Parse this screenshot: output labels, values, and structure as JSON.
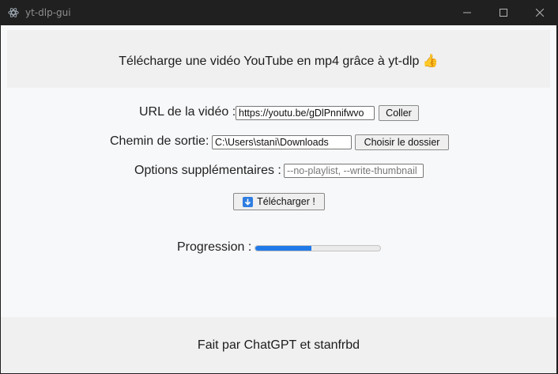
{
  "window": {
    "title": "yt-dlp-gui",
    "minimize_icon": "minimize-icon",
    "maximize_icon": "maximize-icon",
    "close_icon": "close-icon"
  },
  "header": {
    "text": "Télécharge une vidéo YouTube en mp4 grâce à yt-dlp 👍"
  },
  "form": {
    "url_label": "URL de la vidéo :",
    "url_value": "https://youtu.be/gDlPnnifwvo",
    "paste_button": "Coller",
    "output_label": "Chemin de sortie:",
    "output_value": "C:\\Users\\stani\\Downloads",
    "choose_folder_button": "Choisir le dossier",
    "options_label": "Options supplémentaires :",
    "options_placeholder": "--no-playlist, --write-thumbnail",
    "download_button": "Télécharger !",
    "download_icon": "download-arrow-icon"
  },
  "progress": {
    "label": "Progression :",
    "value": 0.45,
    "color": "#1f7ae8"
  },
  "footer": {
    "text": "Fait par ChatGPT et stanfrbd"
  }
}
